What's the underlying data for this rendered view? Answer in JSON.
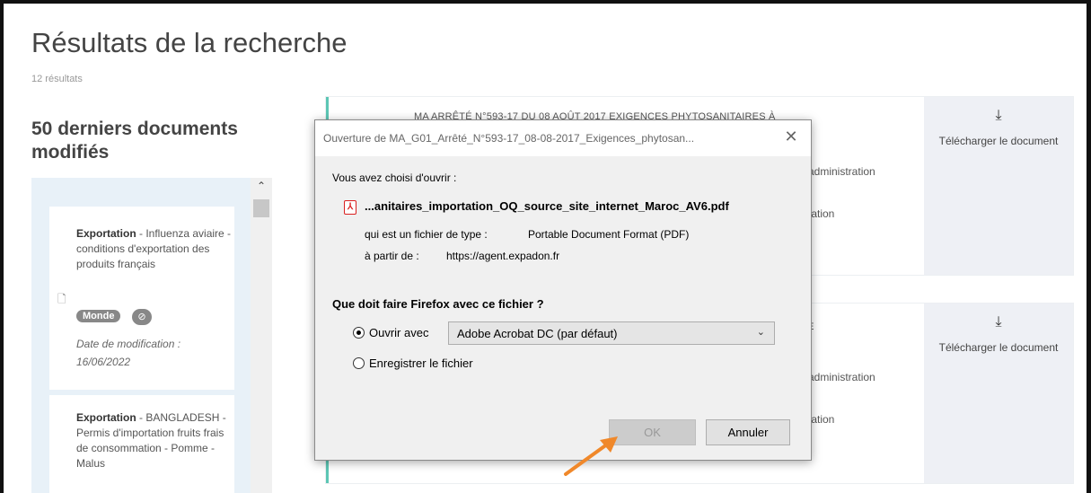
{
  "page": {
    "title": "Résultats de la recherche",
    "result_count": "12 résultats",
    "recent_title": "50 derniers documents modifiés"
  },
  "sidebar": {
    "cards": [
      {
        "title_bold": "Exportation",
        "title_rest": " - Influenza aviaire - conditions d'exportation des produits français",
        "tag": "Monde",
        "modified_label": "Date de modification :",
        "modified_date": "16/06/2022"
      },
      {
        "title_bold": "Exportation",
        "title_rest": " - BANGLADESH - Permis d'importation fruits frais de consommation - Pomme - Malus"
      }
    ]
  },
  "results": [
    {
      "heading": "MA ARRÊTÉ N°593-17 DU 08 AOÛT 2017 EXIGENCES PHYTOSANITAIRES À",
      "line1": "administration",
      "line2": "tation",
      "download_label": "Télécharger le document"
    },
    {
      "heading": "RE",
      "line1": "administration",
      "line2": "tation",
      "download_label": "Télécharger le document"
    }
  ],
  "dialog": {
    "title": "Ouverture de MA_G01_Arrêté_N°593-17_08-08-2017_Exigences_phytosan...",
    "intro": "Vous avez choisi d'ouvrir :",
    "filename": "...anitaires_importation_OQ_source_site_internet_Maroc_AV6.pdf",
    "type_label": "qui est un fichier de type :",
    "type_value": "Portable Document Format (PDF)",
    "from_label": "à partir de :",
    "from_value": "https://agent.expadon.fr",
    "question": "Que doit faire Firefox avec ce fichier ?",
    "open_with_label": "Ouvrir avec",
    "open_with_value": "Adobe Acrobat DC (par défaut)",
    "save_label": "Enregistrer le fichier",
    "ok_label": "OK",
    "cancel_label": "Annuler"
  },
  "colors": {
    "accent": "#5cc6b4",
    "sidebar_bg": "#e8f1f8",
    "download_bg": "#eef0f5",
    "arrow": "#f0882a"
  }
}
